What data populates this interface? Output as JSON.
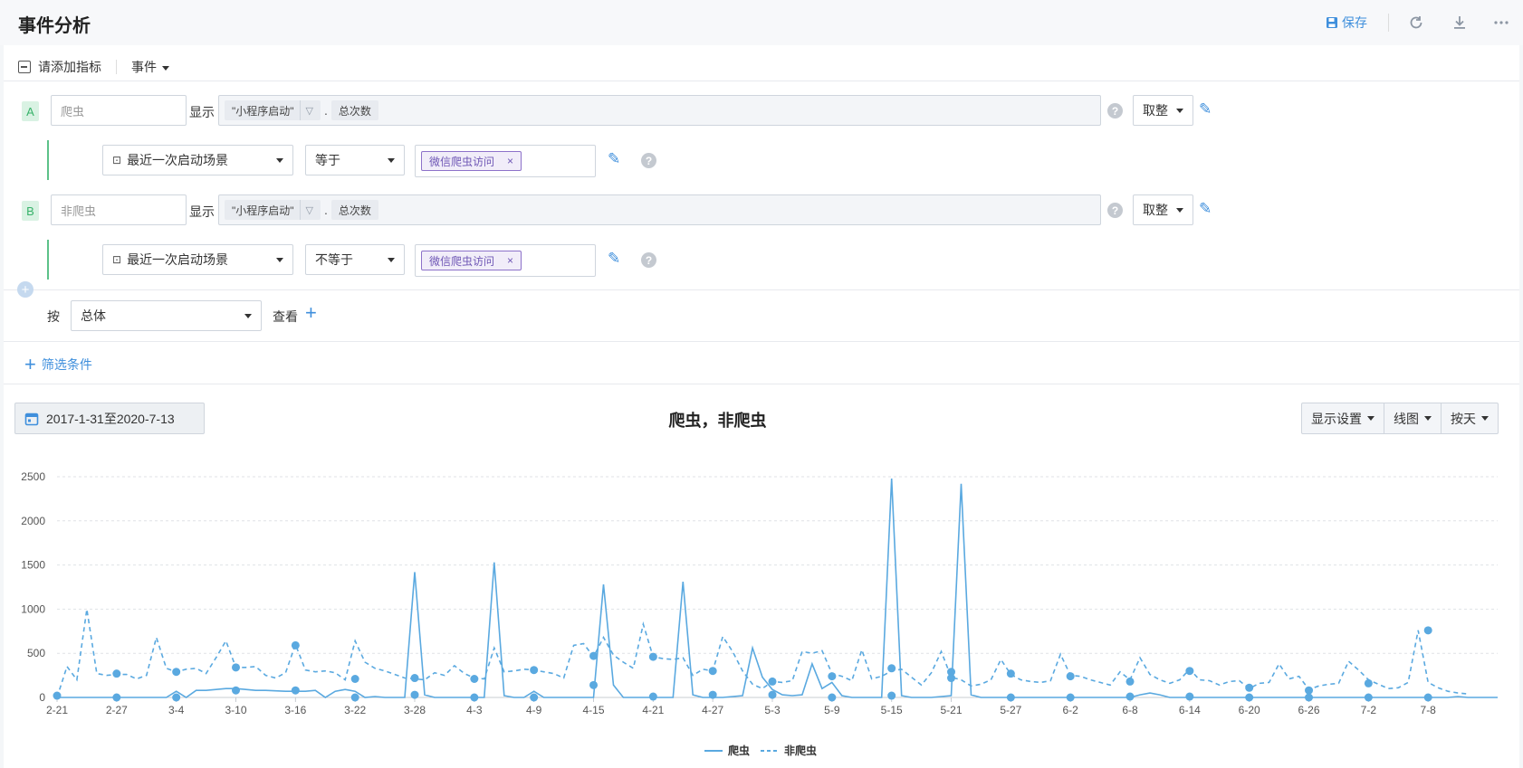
{
  "header": {
    "title": "事件分析",
    "save_label": "保存"
  },
  "metric_bar": {
    "add_metric_label": "请添加指标",
    "event_label": "事件"
  },
  "metrics": [
    {
      "letter": "A",
      "name_placeholder": "爬虫",
      "show_label": "显示",
      "event_chip": "\"小程序启动\"",
      "dot": ".",
      "measure_chip": "总次数",
      "rounding": "取整",
      "filter": {
        "property": "最近一次启动场景",
        "operator": "等于",
        "value": "微信爬虫访问"
      }
    },
    {
      "letter": "B",
      "name_placeholder": "非爬虫",
      "show_label": "显示",
      "event_chip": "\"小程序启动\"",
      "dot": ".",
      "measure_chip": "总次数",
      "rounding": "取整",
      "filter": {
        "property": "最近一次启动场景",
        "operator": "不等于",
        "value": "微信爬虫访问"
      }
    }
  ],
  "group_by": {
    "by_label": "按",
    "value": "总体",
    "view_label": "查看"
  },
  "filter_link": "筛选条件",
  "date_range": "2017-1-31至2020-7-13",
  "chart_controls": {
    "display": "显示设置",
    "chart_type": "线图",
    "granularity": "按天"
  },
  "colors": {
    "accent": "#3f8fdc",
    "series": "#5aa9e0",
    "letter_bg": "#d9f2e3",
    "tag": "#8d72c9"
  },
  "chart_data": {
    "type": "line",
    "title": "爬虫，非爬虫",
    "ylim": [
      0,
      2500
    ],
    "yticks": [
      0,
      500,
      1000,
      1500,
      2000,
      2500
    ],
    "x_tick_labels": [
      "2-21",
      "2-27",
      "3-4",
      "3-10",
      "3-16",
      "3-22",
      "3-28",
      "4-3",
      "4-9",
      "4-15",
      "4-21",
      "4-27",
      "5-3",
      "5-9",
      "5-15",
      "5-21",
      "5-27",
      "6-2",
      "6-8",
      "6-14",
      "6-20",
      "6-26",
      "7-2",
      "7-8"
    ],
    "grid": true,
    "legend": "bottom-center",
    "series": [
      {
        "name": "爬虫",
        "style": "solid",
        "values": [
          0,
          0,
          0,
          0,
          0,
          0,
          0,
          0,
          0,
          0,
          0,
          0,
          70,
          0,
          80,
          80,
          90,
          100,
          100,
          90,
          80,
          80,
          75,
          70,
          70,
          70,
          80,
          0,
          70,
          90,
          70,
          0,
          10,
          0,
          0,
          0,
          1420,
          30,
          0,
          0,
          0,
          0,
          0,
          0,
          1530,
          20,
          0,
          0,
          70,
          0,
          0,
          0,
          0,
          0,
          0,
          1280,
          140,
          0,
          0,
          0,
          0,
          0,
          0,
          1310,
          30,
          0,
          0,
          0,
          10,
          20,
          560,
          230,
          90,
          30,
          20,
          30,
          380,
          100,
          170,
          20,
          0,
          0,
          0,
          0,
          2480,
          20,
          0,
          0,
          0,
          10,
          20,
          2420,
          30,
          0,
          0,
          0,
          0,
          0,
          0,
          0,
          0,
          0,
          0,
          0,
          0,
          0,
          0,
          0,
          0,
          30,
          50,
          30,
          0,
          0,
          0,
          0,
          0,
          0,
          0,
          0,
          0,
          0,
          0,
          0,
          0,
          0,
          0,
          0,
          0,
          0,
          0,
          0,
          0,
          0,
          0,
          0,
          0,
          0,
          0,
          0,
          0,
          10,
          0,
          0,
          0,
          0
        ],
        "markers": [
          [
            0,
            20
          ],
          [
            6,
            0
          ],
          [
            12,
            0
          ],
          [
            18,
            80
          ],
          [
            24,
            80
          ],
          [
            30,
            0
          ],
          [
            36,
            30
          ],
          [
            42,
            0
          ],
          [
            48,
            0
          ],
          [
            54,
            140
          ],
          [
            60,
            10
          ],
          [
            66,
            30
          ],
          [
            72,
            30
          ],
          [
            78,
            0
          ],
          [
            84,
            20
          ],
          [
            90,
            220
          ],
          [
            96,
            0
          ],
          [
            102,
            0
          ],
          [
            108,
            10
          ],
          [
            114,
            10
          ],
          [
            120,
            0
          ],
          [
            126,
            0
          ],
          [
            132,
            0
          ],
          [
            138,
            0
          ]
        ]
      },
      {
        "name": "非爬虫",
        "style": "dashed",
        "values": [
          0,
          350,
          200,
          1000,
          270,
          250,
          260,
          260,
          210,
          250,
          680,
          330,
          290,
          320,
          330,
          270,
          450,
          640,
          340,
          340,
          350,
          250,
          220,
          280,
          600,
          310,
          290,
          300,
          280,
          200,
          640,
          400,
          330,
          300,
          260,
          220,
          210,
          200,
          280,
          250,
          360,
          270,
          220,
          210,
          560,
          290,
          300,
          320,
          310,
          290,
          270,
          220,
          590,
          610,
          460,
          680,
          480,
          400,
          330,
          830,
          460,
          440,
          430,
          450,
          250,
          320,
          300,
          690,
          520,
          300,
          150,
          100,
          180,
          170,
          190,
          520,
          500,
          530,
          270,
          240,
          190,
          540,
          210,
          240,
          300,
          320,
          230,
          140,
          280,
          520,
          230,
          200,
          130,
          150,
          200,
          430,
          260,
          200,
          180,
          170,
          190,
          490,
          250,
          240,
          200,
          170,
          140,
          290,
          200,
          450,
          260,
          200,
          160,
          200,
          320,
          200,
          190,
          140,
          180,
          190,
          100,
          160,
          170,
          380,
          210,
          240,
          90,
          130,
          150,
          160,
          410,
          310,
          200,
          150,
          100,
          110,
          170,
          760,
          170,
          110,
          70,
          50,
          40
        ],
        "markers": [
          [
            6,
            270
          ],
          [
            12,
            290
          ],
          [
            18,
            340
          ],
          [
            24,
            590
          ],
          [
            30,
            210
          ],
          [
            36,
            220
          ],
          [
            42,
            210
          ],
          [
            48,
            310
          ],
          [
            54,
            470
          ],
          [
            60,
            460
          ],
          [
            66,
            300
          ],
          [
            72,
            180
          ],
          [
            78,
            240
          ],
          [
            84,
            330
          ],
          [
            90,
            290
          ],
          [
            96,
            270
          ],
          [
            102,
            240
          ],
          [
            108,
            180
          ],
          [
            114,
            300
          ],
          [
            120,
            110
          ],
          [
            126,
            80
          ],
          [
            132,
            160
          ],
          [
            138,
            760
          ]
        ]
      }
    ]
  }
}
